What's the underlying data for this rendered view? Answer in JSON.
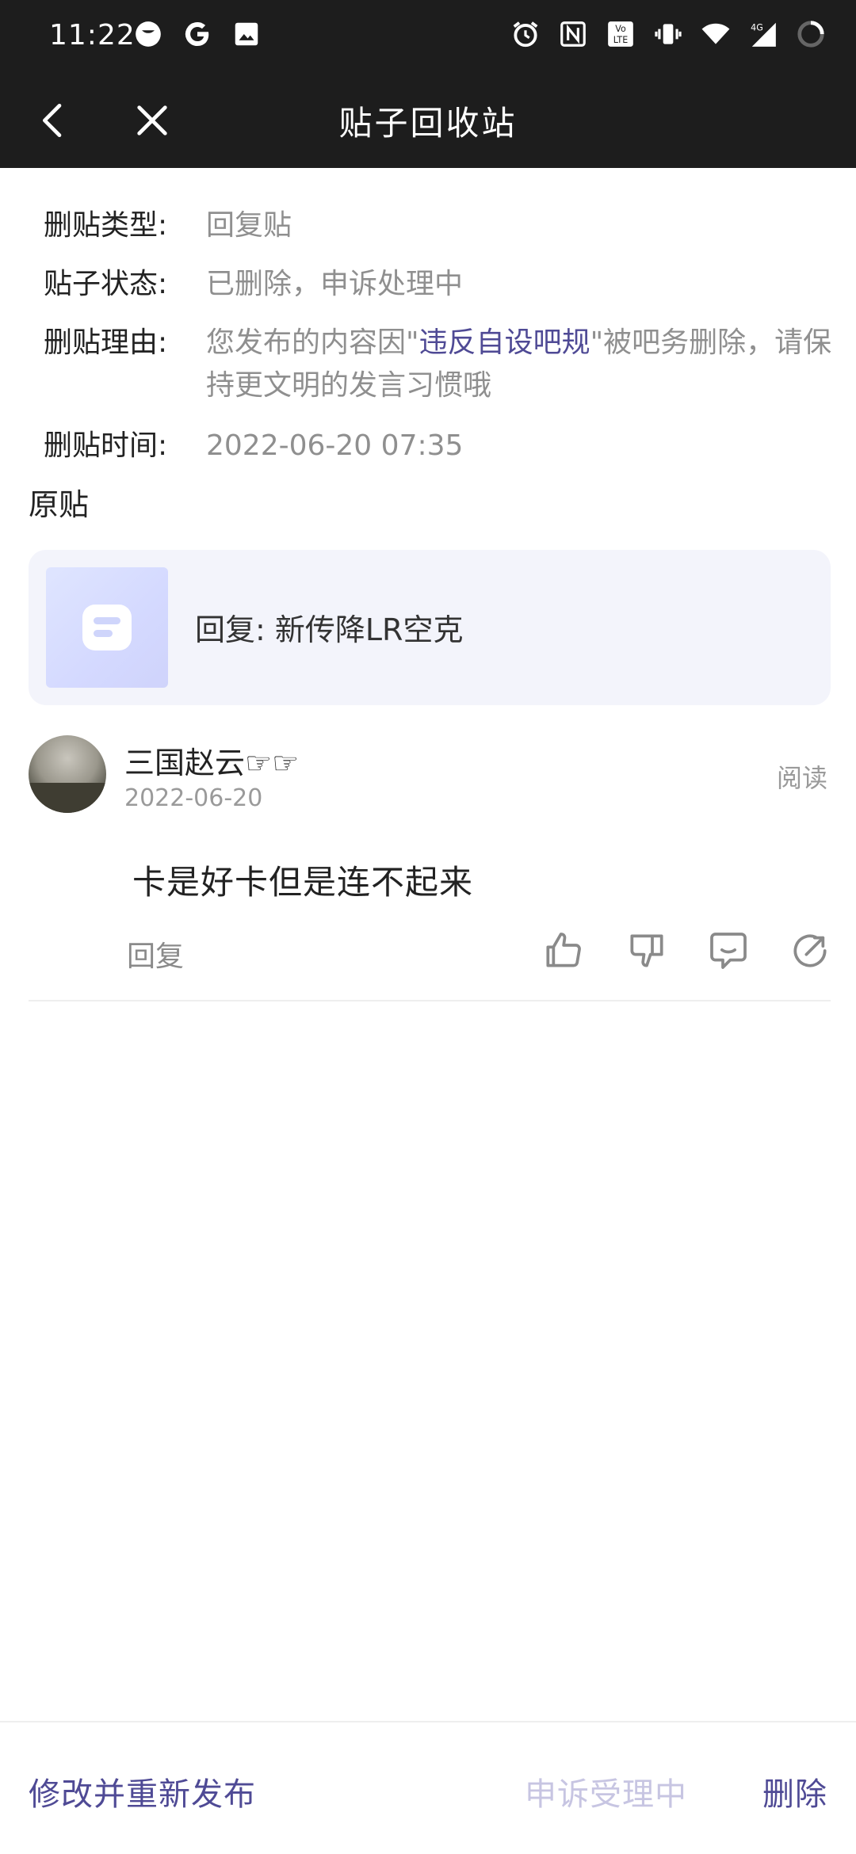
{
  "status_bar": {
    "time": "11:22",
    "left_icons": [
      "moon-icon",
      "google-icon",
      "image-icon"
    ],
    "right_icons": [
      "alarm-icon",
      "nfc-icon",
      "volte-icon",
      "vibrate-icon",
      "wifi-icon",
      "signal-4g-icon",
      "battery-icon"
    ]
  },
  "header": {
    "title": "贴子回收站",
    "back_icon": "chevron-left-icon",
    "close_icon": "close-icon"
  },
  "info": {
    "type_label": "删贴类型:",
    "type_value": "回复贴",
    "status_label": "贴子状态:",
    "status_value": "已删除，申诉处理中",
    "reason_label": "删贴理由:",
    "reason_prefix": "您发布的内容因\"",
    "reason_highlight": "违反自设吧规",
    "reason_suffix": "\"被吧务删除，请保持更文明的发言习惯哦",
    "time_label": "删贴时间:",
    "time_value": "2022-06-20 07:35"
  },
  "original": {
    "section_label": "原贴",
    "card_text": "回复: 新传降LR空克"
  },
  "comment": {
    "username": "三国赵云☞☞",
    "date": "2022-06-20",
    "read_label": "阅读",
    "content": "卡是好卡但是连不起来",
    "reply_label": "回复"
  },
  "bottom": {
    "edit_label": "修改并重新发布",
    "appeal_label": "申诉受理中",
    "delete_label": "删除"
  },
  "colors": {
    "accent": "#4f4a95",
    "header_bg": "#1d1d1d",
    "muted": "#8f8f8f",
    "card_bg": "#f3f4fb"
  }
}
